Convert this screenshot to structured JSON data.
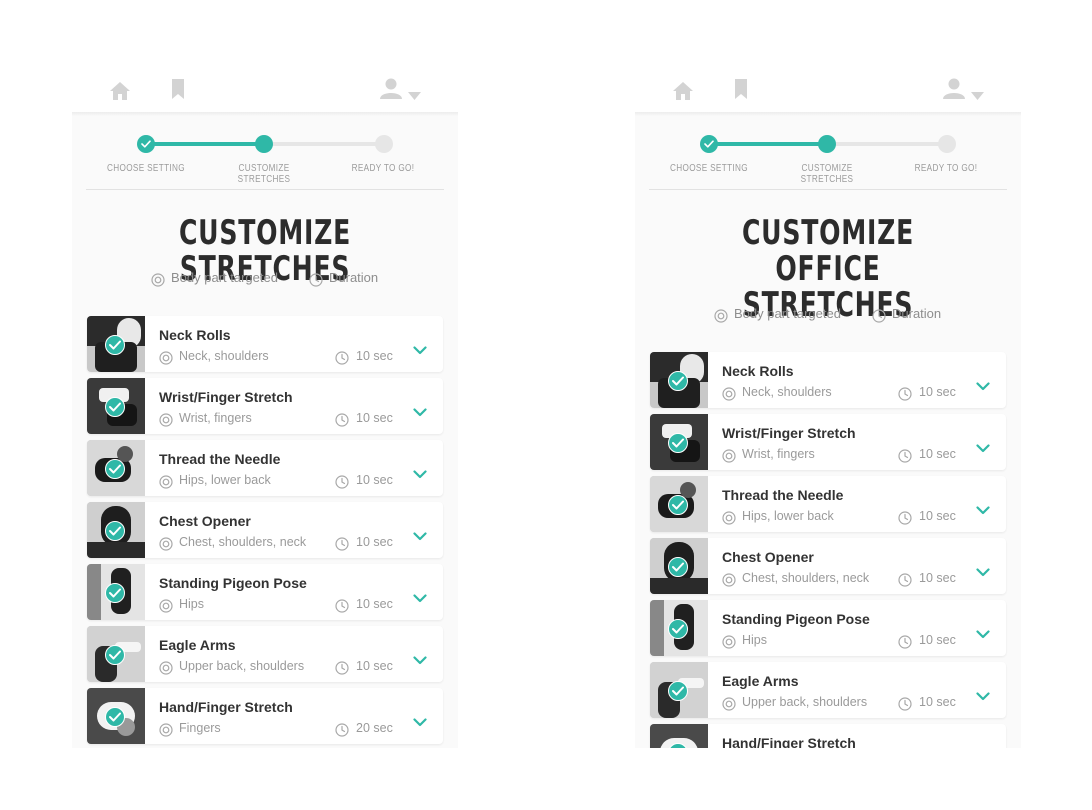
{
  "colors": {
    "accent": "#2fb8a7",
    "inactive": "#e6e6e6",
    "icon_gray": "#d3d3d3"
  },
  "icons": {
    "home": "home-icon",
    "bookmark": "bookmark-icon",
    "user": "user-icon",
    "caret": "caret-down-icon",
    "body_part": "target-icon",
    "duration": "clock-icon",
    "check": "check-icon",
    "expand": "chevron-down-icon"
  },
  "steps": [
    {
      "label": "CHOOSE SETTING",
      "state": "complete"
    },
    {
      "label": "CUSTOMIZE STRETCHES",
      "state": "current"
    },
    {
      "label": "READY TO GO!",
      "state": "upcoming"
    }
  ],
  "legend": {
    "body_part": "Body part targeted",
    "duration": "Duration"
  },
  "panels": [
    {
      "title_lines": [
        "CUSTOMIZE STRETCHES"
      ],
      "stretches": [
        {
          "name": "Neck Rolls",
          "body_parts": "Neck, shoulders",
          "duration": "10 sec",
          "selected": true
        },
        {
          "name": "Wrist/Finger Stretch",
          "body_parts": "Wrist, fingers",
          "duration": "10 sec",
          "selected": true
        },
        {
          "name": "Thread the Needle",
          "body_parts": "Hips, lower back",
          "duration": "10 sec",
          "selected": true
        },
        {
          "name": "Chest Opener",
          "body_parts": "Chest, shoulders, neck",
          "duration": "10 sec",
          "selected": true
        },
        {
          "name": "Standing Pigeon Pose",
          "body_parts": "Hips",
          "duration": "10 sec",
          "selected": true
        },
        {
          "name": "Eagle Arms",
          "body_parts": "Upper back, shoulders",
          "duration": "10 sec",
          "selected": true
        },
        {
          "name": "Hand/Finger Stretch",
          "body_parts": "Fingers",
          "duration": "20 sec",
          "selected": true
        }
      ]
    },
    {
      "title_lines": [
        "CUSTOMIZE OFFICE",
        "STRETCHES"
      ],
      "stretches": [
        {
          "name": "Neck Rolls",
          "body_parts": "Neck, shoulders",
          "duration": "10 sec",
          "selected": true
        },
        {
          "name": "Wrist/Finger Stretch",
          "body_parts": "Wrist, fingers",
          "duration": "10 sec",
          "selected": true
        },
        {
          "name": "Thread the Needle",
          "body_parts": "Hips, lower back",
          "duration": "10 sec",
          "selected": true
        },
        {
          "name": "Chest Opener",
          "body_parts": "Chest, shoulders, neck",
          "duration": "10 sec",
          "selected": true
        },
        {
          "name": "Standing Pigeon Pose",
          "body_parts": "Hips",
          "duration": "10 sec",
          "selected": true
        },
        {
          "name": "Eagle Arms",
          "body_parts": "Upper back, shoulders",
          "duration": "10 sec",
          "selected": true
        },
        {
          "name": "Hand/Finger Stretch",
          "body_parts": "",
          "duration": "",
          "selected": true
        }
      ]
    }
  ]
}
